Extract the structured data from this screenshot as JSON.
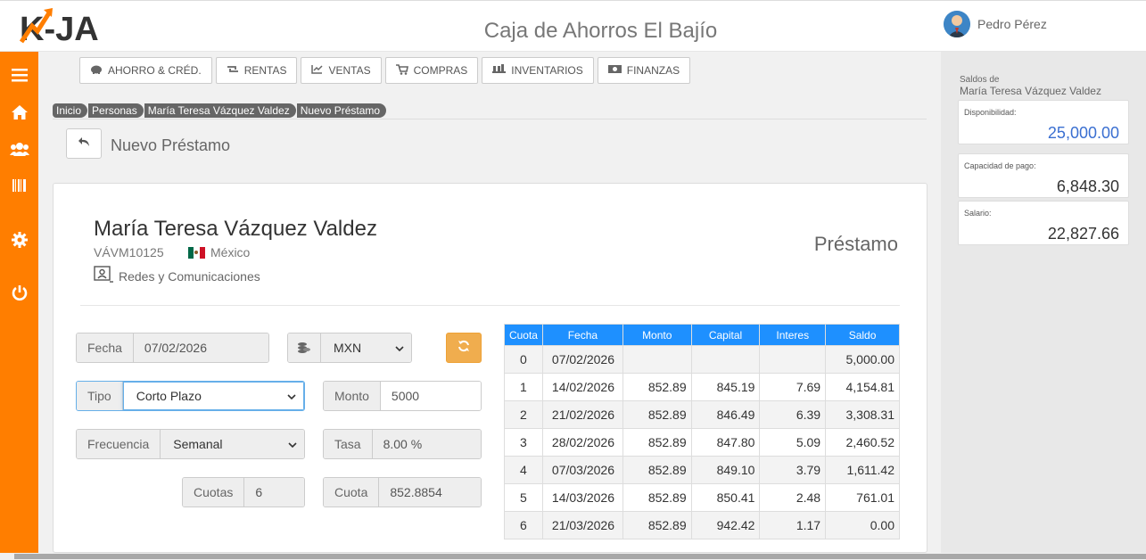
{
  "app": {
    "logo_text": "K-JA",
    "title": "Caja de Ahorros El Bajío",
    "accent": "#ff7e00",
    "user": {
      "name": "Pedro Pérez"
    }
  },
  "sidebar": {
    "icons": [
      "menu-icon",
      "home-icon",
      "users-icon",
      "barcode-icon",
      "gear-icon",
      "power-icon"
    ]
  },
  "nav": {
    "items": [
      {
        "label": "AHORRO & CRÉD.",
        "icon": "piggy-bank-icon"
      },
      {
        "label": "RENTAS",
        "icon": "retweet-icon"
      },
      {
        "label": "VENTAS",
        "icon": "line-chart-icon"
      },
      {
        "label": "COMPRAS",
        "icon": "cart-icon"
      },
      {
        "label": "INVENTARIOS",
        "icon": "truck-icon"
      },
      {
        "label": "FINANZAS",
        "icon": "money-icon"
      }
    ]
  },
  "breadcrumb": [
    "Inicio",
    "Personas",
    "María Teresa Vázquez Valdez",
    "Nuevo Préstamo"
  ],
  "page": {
    "title": "Nuevo Préstamo"
  },
  "person": {
    "name": "María Teresa Vázquez Valdez",
    "id": "VÁVM10125",
    "country": "México",
    "occupation": "Redes y Comunicaciones"
  },
  "loan_label": "Préstamo",
  "form": {
    "fecha": {
      "label": "Fecha",
      "value": "07/02/2026"
    },
    "currency": {
      "value": "MXN"
    },
    "tipo": {
      "label": "Tipo",
      "value": "Corto Plazo"
    },
    "monto": {
      "label": "Monto",
      "value": "5000"
    },
    "frecuencia": {
      "label": "Frecuencia",
      "value": "Semanal"
    },
    "tasa": {
      "label": "Tasa",
      "value": "8.00 %"
    },
    "cuotas": {
      "label": "Cuotas",
      "value": "6"
    },
    "cuota": {
      "label": "Cuota",
      "value": "852.8854"
    }
  },
  "table": {
    "headers": [
      "Cuota",
      "Fecha",
      "Monto",
      "Capital",
      "Interes",
      "Saldo"
    ],
    "rows": [
      [
        "0",
        "07/02/2026",
        "",
        "",
        "",
        "5,000.00"
      ],
      [
        "1",
        "14/02/2026",
        "852.89",
        "845.19",
        "7.69",
        "4,154.81"
      ],
      [
        "2",
        "21/02/2026",
        "852.89",
        "846.49",
        "6.39",
        "3,308.31"
      ],
      [
        "3",
        "28/02/2026",
        "852.89",
        "847.80",
        "5.09",
        "2,460.52"
      ],
      [
        "4",
        "07/03/2026",
        "852.89",
        "849.10",
        "3.79",
        "1,611.42"
      ],
      [
        "5",
        "14/03/2026",
        "852.89",
        "850.41",
        "2.48",
        "761.01"
      ],
      [
        "6",
        "21/03/2026",
        "852.89",
        "942.42",
        "1.17",
        "0.00"
      ]
    ]
  },
  "summary": {
    "label": "Saldos de",
    "name": "María Teresa Vázquez Valdez",
    "boxes": [
      {
        "label": "Disponibilidad:",
        "value": "25,000.00"
      },
      {
        "label": "Capacidad de pago:",
        "value": "6,848.30"
      },
      {
        "label": "Salario:",
        "value": "22,827.66"
      }
    ]
  }
}
